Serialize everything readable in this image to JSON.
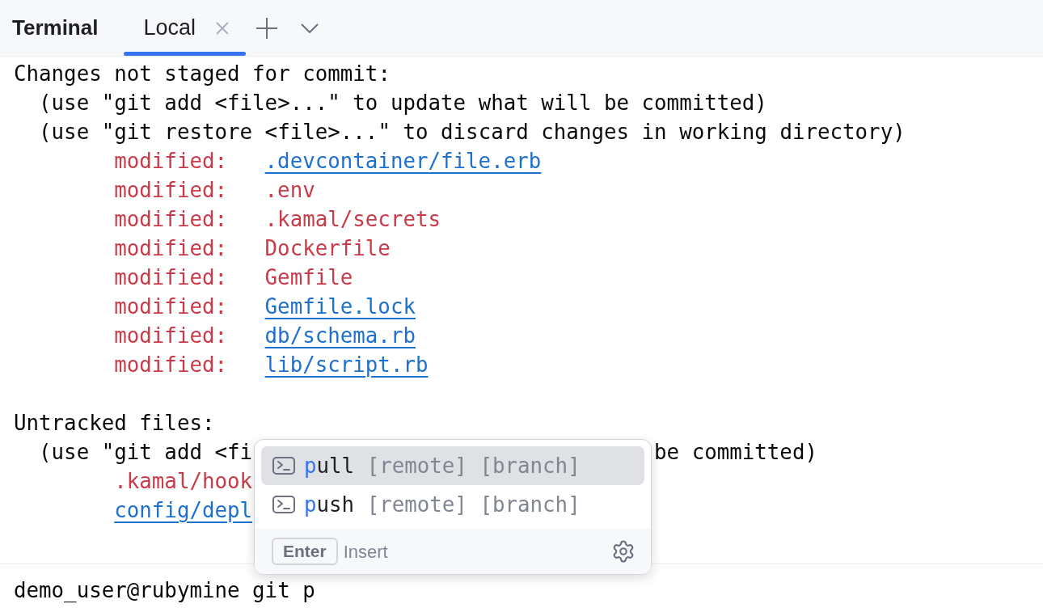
{
  "tool_window": {
    "title": "Terminal",
    "tabs": [
      {
        "label": "Local",
        "selected": true
      }
    ]
  },
  "output": [
    {
      "kind": "heading",
      "text": "Changes not staged for commit:"
    },
    {
      "kind": "hint",
      "text": "(use \"git add <file>...\" to update what will be committed)"
    },
    {
      "kind": "hint",
      "text": "(use \"git restore <file>...\" to discard changes in working directory)"
    },
    {
      "kind": "file",
      "status": "modified:",
      "path": ".devcontainer/file.erb",
      "link": true
    },
    {
      "kind": "file",
      "status": "modified:",
      "path": ".env",
      "link": false
    },
    {
      "kind": "file",
      "status": "modified:",
      "path": ".kamal/secrets",
      "link": false
    },
    {
      "kind": "file",
      "status": "modified:",
      "path": "Dockerfile",
      "link": false
    },
    {
      "kind": "file",
      "status": "modified:",
      "path": "Gemfile",
      "link": false
    },
    {
      "kind": "file",
      "status": "modified:",
      "path": "Gemfile.lock",
      "link": true
    },
    {
      "kind": "file",
      "status": "modified:",
      "path": "db/schema.rb",
      "link": true
    },
    {
      "kind": "file",
      "status": "modified:",
      "path": "lib/script.rb",
      "link": true
    },
    {
      "kind": "blank"
    },
    {
      "kind": "heading",
      "text": "Untracked files:"
    },
    {
      "kind": "hint",
      "text": "(use \"git add <fi",
      "text_after": "be committed)"
    },
    {
      "kind": "file",
      "path": ".kamal/hook",
      "link": false
    },
    {
      "kind": "file",
      "path": "config/depl",
      "link": true
    }
  ],
  "prompt": {
    "user_host": "demo_user@rubymine",
    "command": "git p"
  },
  "completion_popup": {
    "items": [
      {
        "match": "p",
        "rest": "ull",
        "args": "[remote] [branch]",
        "selected": true
      },
      {
        "match": "p",
        "rest": "ush",
        "args": "[remote] [branch]",
        "selected": false
      }
    ],
    "footer": {
      "key": "Enter",
      "action": "Insert"
    }
  }
}
